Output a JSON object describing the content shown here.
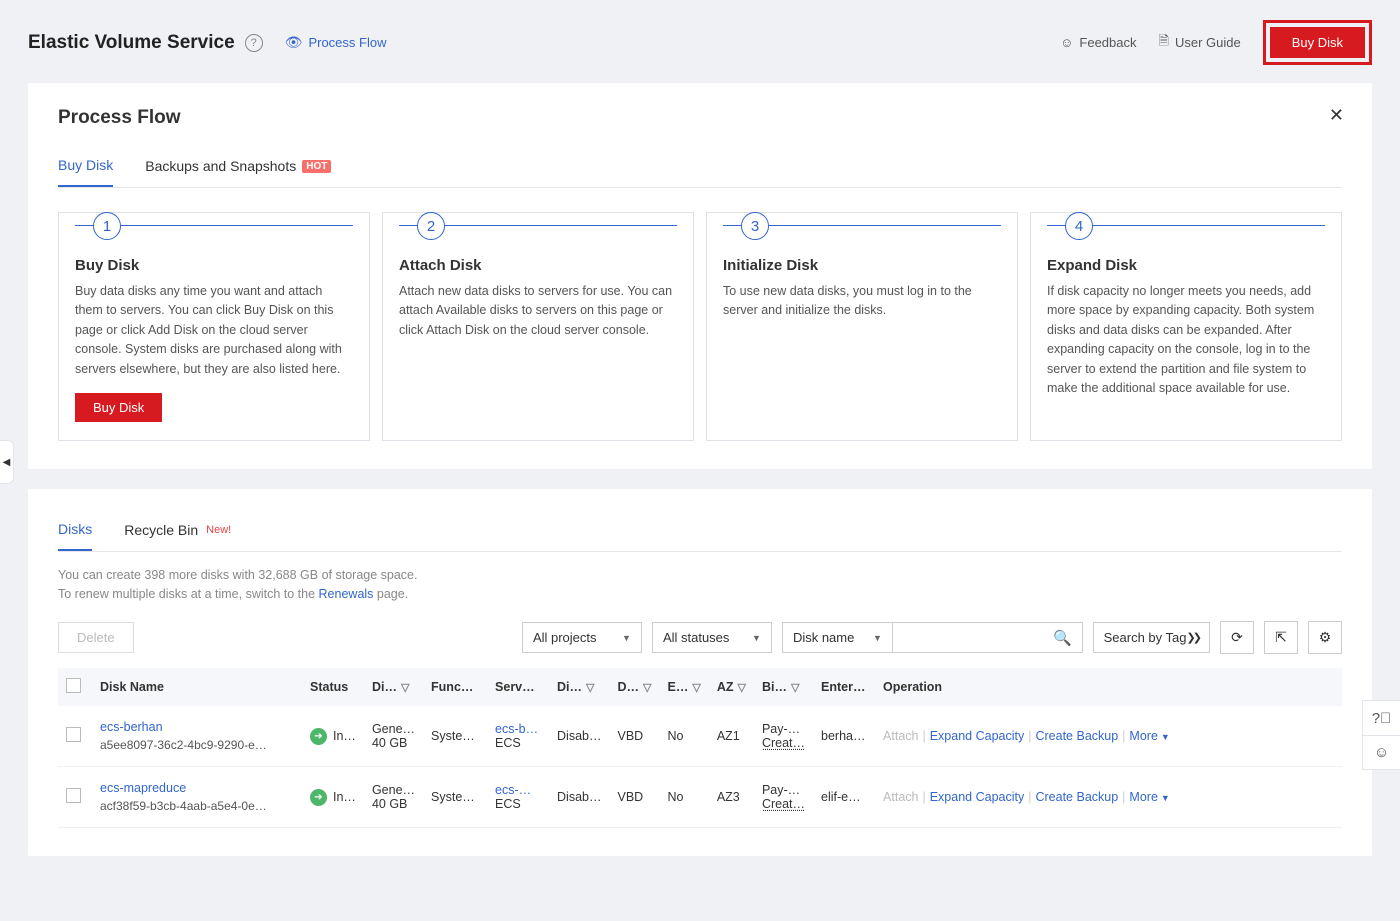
{
  "header": {
    "title": "Elastic Volume Service",
    "process_flow_link": "Process Flow",
    "feedback": "Feedback",
    "user_guide": "User Guide",
    "buy_disk": "Buy Disk"
  },
  "process_panel": {
    "title": "Process Flow",
    "tabs": {
      "buy_disk": "Buy Disk",
      "backups": "Backups and Snapshots",
      "hot": "HOT"
    },
    "steps": [
      {
        "num": "1",
        "title": "Buy Disk",
        "desc": "Buy data disks any time you want and attach them to servers. You can click Buy Disk on this page or click Add Disk on the cloud server console. System disks are purchased along with servers elsewhere, but they are also listed here.",
        "btn": "Buy Disk"
      },
      {
        "num": "2",
        "title": "Attach Disk",
        "desc": "Attach new data disks to servers for use. You can attach Available disks to servers on this page or click Attach Disk on the cloud server console."
      },
      {
        "num": "3",
        "title": "Initialize Disk",
        "desc": "To use new data disks, you must log in to the server and initialize the disks."
      },
      {
        "num": "4",
        "title": "Expand Disk",
        "desc": "If disk capacity no longer meets you needs, add more space by expanding capacity. Both system disks and data disks can be expanded. After expanding capacity on the console, log in to the server to extend the partition and file system to make the additional space available for use."
      }
    ]
  },
  "disks_panel": {
    "tabs": {
      "disks": "Disks",
      "recycle": "Recycle Bin",
      "new": "New!"
    },
    "info": {
      "line1a": "You can create 398 more disks with 32,688 GB of storage space.",
      "line2a": "To renew multiple disks at a time, switch to the ",
      "renewals": "Renewals",
      "line2b": " page."
    },
    "toolbar": {
      "delete": "Delete",
      "projects": "All projects",
      "statuses": "All statuses",
      "search_field": "Disk name",
      "search_by_tag": "Search by Tag"
    },
    "columns": {
      "disk_name": "Disk Name",
      "status": "Status",
      "disk": "Di…",
      "func": "Func…",
      "server": "Serv…",
      "encrypt": "Di…",
      "device": "D…",
      "share": "E…",
      "az": "AZ",
      "billing": "Bi…",
      "enterprise": "Enter…",
      "operation": "Operation"
    },
    "rows": [
      {
        "name": "ecs-berhan",
        "id": "a5ee8097-36c2-4bc9-9290-e…",
        "status": "In…",
        "disk_type": "Gene…",
        "disk_size": "40 GB",
        "func": "Syste…",
        "server_link": "ecs-b…",
        "server_type": "ECS",
        "encrypt": "Disab…",
        "device": "VBD",
        "share": "No",
        "az": "AZ1",
        "billing1": "Pay-…",
        "billing2": "Creat…",
        "enterprise": "berha…"
      },
      {
        "name": "ecs-mapreduce",
        "id": "acf38f59-b3cb-4aab-a5e4-0e…",
        "status": "In…",
        "disk_type": "Gene…",
        "disk_size": "40 GB",
        "func": "Syste…",
        "server_link": "ecs-…",
        "server_type": "ECS",
        "encrypt": "Disab…",
        "device": "VBD",
        "share": "No",
        "az": "AZ3",
        "billing1": "Pay-…",
        "billing2": "Creat…",
        "enterprise": "elif-e…"
      }
    ],
    "ops": {
      "attach": "Attach",
      "expand": "Expand Capacity",
      "backup": "Create Backup",
      "more": "More"
    }
  }
}
